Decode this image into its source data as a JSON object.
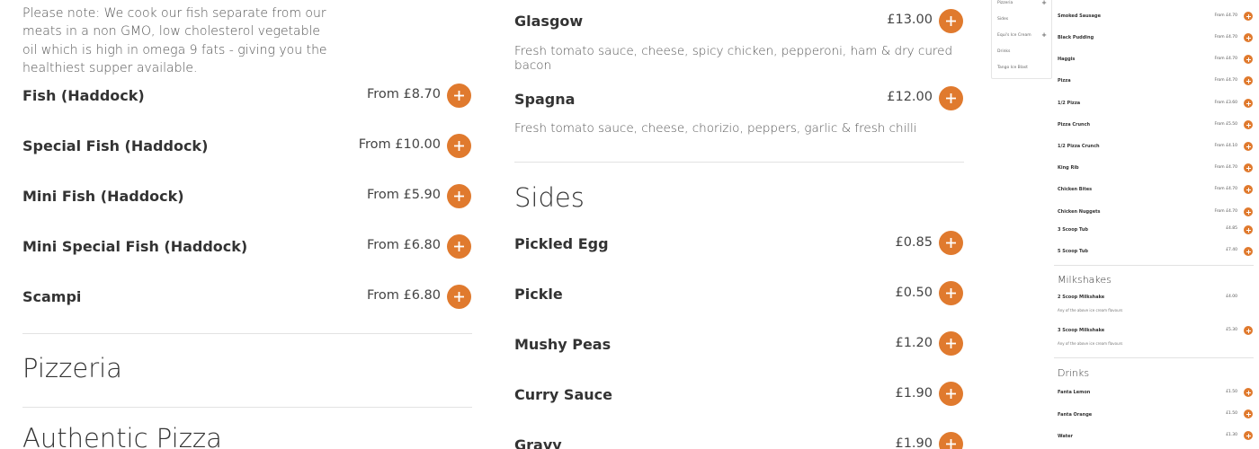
{
  "note": "Please note: We cook our fish separate from our meats in a non GMO, low cholesterol vegetable oil which is high in omega 9 fats - giving you the healthiest supper available.",
  "fish_items": [
    {
      "name": "Fish (Haddock)",
      "price": "From £8.70"
    },
    {
      "name": "Special Fish (Haddock)",
      "price": "From £10.00"
    },
    {
      "name": "Mini Fish (Haddock)",
      "price": "From £5.90"
    },
    {
      "name": "Mini Special Fish (Haddock)",
      "price": "From £6.80"
    },
    {
      "name": "Scampi",
      "price": "From £6.80"
    }
  ],
  "pizzeria_title": "Pizzeria",
  "authentic_pizza_title": "Authentic Pizza",
  "pizzas": [
    {
      "name": "Glasgow",
      "price": "£13.00",
      "desc": "Fresh tomato sauce, cheese, spicy chicken, pepperoni, ham & dry cured bacon"
    },
    {
      "name": "Spagna",
      "price": "£12.00",
      "desc": "Fresh tomato sauce, cheese, chorizio, peppers, garlic & fresh chilli"
    }
  ],
  "sides_title": "Sides",
  "sides": [
    {
      "name": "Pickled Egg",
      "price": "£0.85"
    },
    {
      "name": "Pickle",
      "price": "£0.50"
    },
    {
      "name": "Mushy Peas",
      "price": "£1.20"
    },
    {
      "name": "Curry Sauce",
      "price": "£1.90"
    },
    {
      "name": "Gravy",
      "price": "£1.90"
    }
  ],
  "thumb_nav": [
    {
      "label": "Pizzeria",
      "plus": "+"
    },
    {
      "label": "Sides",
      "plus": ""
    },
    {
      "label": "Equi's Ice Cream",
      "plus": "+"
    },
    {
      "label": "Drinks",
      "plus": ""
    },
    {
      "label": "Tango Ice Blast",
      "plus": ""
    }
  ],
  "thumb_items": [
    {
      "name": "Smoked Sausage",
      "price": "From £4.70"
    },
    {
      "name": "Black Pudding",
      "price": "From £4.70"
    },
    {
      "name": "Haggis",
      "price": "From £4.70"
    },
    {
      "name": "Pizza",
      "price": "From £4.70"
    },
    {
      "name": "1/2 Pizza",
      "price": "From £3.60"
    },
    {
      "name": "Pizza Crunch",
      "price": "From £5.50"
    },
    {
      "name": "1/2 Pizza Crunch",
      "price": "From £4.10"
    },
    {
      "name": "King Rib",
      "price": "From £4.70"
    },
    {
      "name": "Chicken Bites",
      "price": "From £4.70"
    },
    {
      "name": "Chicken Nuggets",
      "price": "From £4.70"
    },
    {
      "name": "3 Scoop Tub",
      "price": "£4.85"
    },
    {
      "name": "5 Scoop Tub",
      "price": "£7.40"
    }
  ],
  "thumb_milkshakes_title": "Milkshakes",
  "thumb_milkshakes": [
    {
      "name": "2 Scoop Milkshake",
      "price": "£4.00",
      "sub": "Any of the above ice cream flavours"
    },
    {
      "name": "3 Scoop Milkshake",
      "price": "£5.30",
      "sub": "Any of the above ice cream flavours"
    }
  ],
  "thumb_drinks_title": "Drinks",
  "thumb_drinks": [
    {
      "name": "Fanta Lemon",
      "price": "£1.50"
    },
    {
      "name": "Fanta Orange",
      "price": "£1.50"
    },
    {
      "name": "Water",
      "price": "£1.30"
    }
  ],
  "colors": {
    "accent": "#e07a2e",
    "text": "#333333",
    "divider": "#e2e2e2"
  }
}
